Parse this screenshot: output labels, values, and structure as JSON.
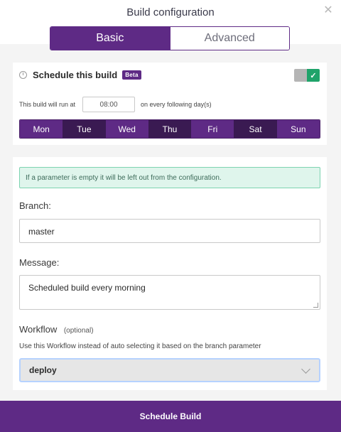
{
  "dialog": {
    "title": "Build configuration",
    "close_icon": "close-icon",
    "close_glyph": "✕"
  },
  "tabs": [
    {
      "label": "Basic",
      "active": true
    },
    {
      "label": "Advanced",
      "active": false
    }
  ],
  "schedule": {
    "title": "Schedule this build",
    "badge": "Beta",
    "toggle_on": true,
    "toggle_check": "✓",
    "run_prefix": "This build will run at",
    "time_value": "08:00",
    "run_suffix": "on every following day(s)",
    "days": [
      "Mon",
      "Tue",
      "Wed",
      "Thu",
      "Fri",
      "Sat",
      "Sun"
    ]
  },
  "params": {
    "notice": "If a parameter is empty it will be left out from the configuration.",
    "branch_label": "Branch:",
    "branch_value": "master",
    "message_label": "Message:",
    "message_value": "Scheduled build every morning",
    "workflow_label": "Workflow",
    "workflow_optional": "(optional)",
    "workflow_helper": "Use this Workflow instead of auto selecting it based on the branch parameter",
    "workflow_value": "deploy"
  },
  "footer": {
    "submit_label": "Schedule Build"
  },
  "colors": {
    "brand": "#5e2a85",
    "success": "#1fa36a",
    "notice_bg": "#dff5ec"
  }
}
